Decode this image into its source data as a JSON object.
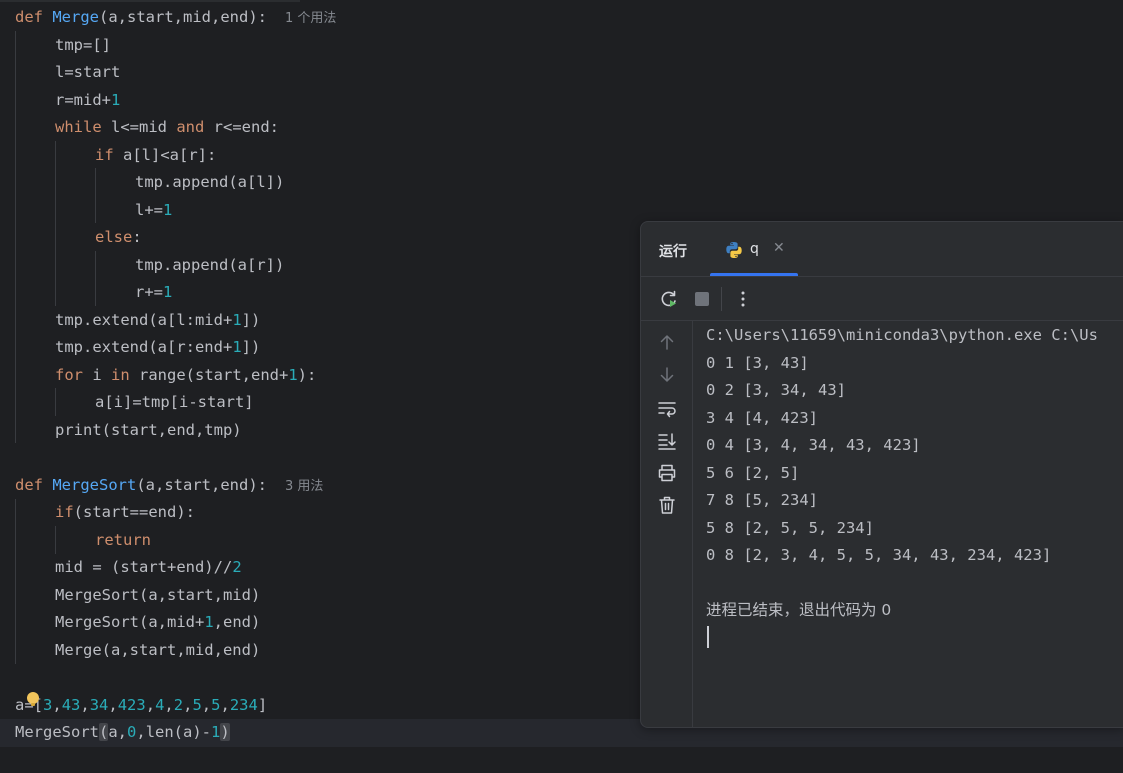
{
  "editor": {
    "merge_def": {
      "kw": "def",
      "name": "Merge",
      "params": "(a,start,mid,end):",
      "usages": "1 个用法"
    },
    "merge_body": {
      "l1": "tmp=[]",
      "l2": "l=start",
      "l3_a": "r=mid+",
      "l3_n": "1",
      "l4_kw": "while",
      "l4_a": " l<=mid ",
      "l4_kw2": "and",
      "l4_b": " r<=end:",
      "l5_kw": "if",
      "l5_a": " a[l]<a[r]:",
      "l6": "tmp.append(a[l])",
      "l7_a": "l+=",
      "l7_n": "1",
      "l8_kw": "else",
      "l8_a": ":",
      "l9": "tmp.append(a[r])",
      "l10_a": "r+=",
      "l10_n": "1",
      "l11_a": "tmp.extend(a[l:mid+",
      "l11_n": "1",
      "l11_b": "])",
      "l12_a": "tmp.extend(a[r:end+",
      "l12_n": "1",
      "l12_b": "])",
      "l13_kw": "for",
      "l13_a": " i ",
      "l13_kw2": "in",
      "l13_b": " range(start,end+",
      "l13_n": "1",
      "l13_c": "):",
      "l14": "a[i]=tmp[i-start]",
      "l15": "print(start,end,tmp)"
    },
    "mergesort_def": {
      "kw": "def",
      "name": "MergeSort",
      "params": "(a,start,end):",
      "usages": "3 用法"
    },
    "mergesort_body": {
      "l1_kw": "if",
      "l1_a": "(start==end):",
      "l2_kw": "return",
      "l3_a": "mid = (start+end)//",
      "l3_n": "2",
      "l4": "MergeSort(a,start,mid)",
      "l5_a": "MergeSort(a,mid+",
      "l5_n": "1",
      "l5_b": ",end)",
      "l6": "Merge(a,start,mid,end)"
    },
    "array_line": {
      "a": "a=[",
      "n1": "3",
      "n2": "43",
      "n3": "34",
      "n4": "423",
      "n5": "4",
      "n6": "2",
      "n7": "5",
      "n8": "5",
      "n9": "234",
      "comma": ",",
      "end": "]"
    },
    "call_line": {
      "a": "MergeSort",
      "p_open": "(",
      "b": "a,",
      "n0": "0",
      "c": ",len(a)-",
      "n1": "1",
      "p_close": ")"
    }
  },
  "run_panel": {
    "title": "运行",
    "tab_label": "q",
    "console_lines": [
      "C:\\Users\\11659\\miniconda3\\python.exe C:\\Us",
      "0 1 [3, 43]",
      "0 2 [3, 34, 43]",
      "3 4 [4, 423]",
      "0 4 [3, 4, 34, 43, 423]",
      "5 6 [2, 5]",
      "7 8 [5, 234]",
      "5 8 [2, 5, 5, 234]",
      "0 8 [2, 3, 4, 5, 5, 34, 43, 234, 423]",
      "",
      "进程已结束，退出代码为 0"
    ]
  },
  "colors": {
    "background": "#1e1f22",
    "keyword": "#cf8e6d",
    "number": "#2aacb8",
    "function_name": "#56a8f5",
    "text": "#bcbec4",
    "accent": "#3574f0"
  }
}
